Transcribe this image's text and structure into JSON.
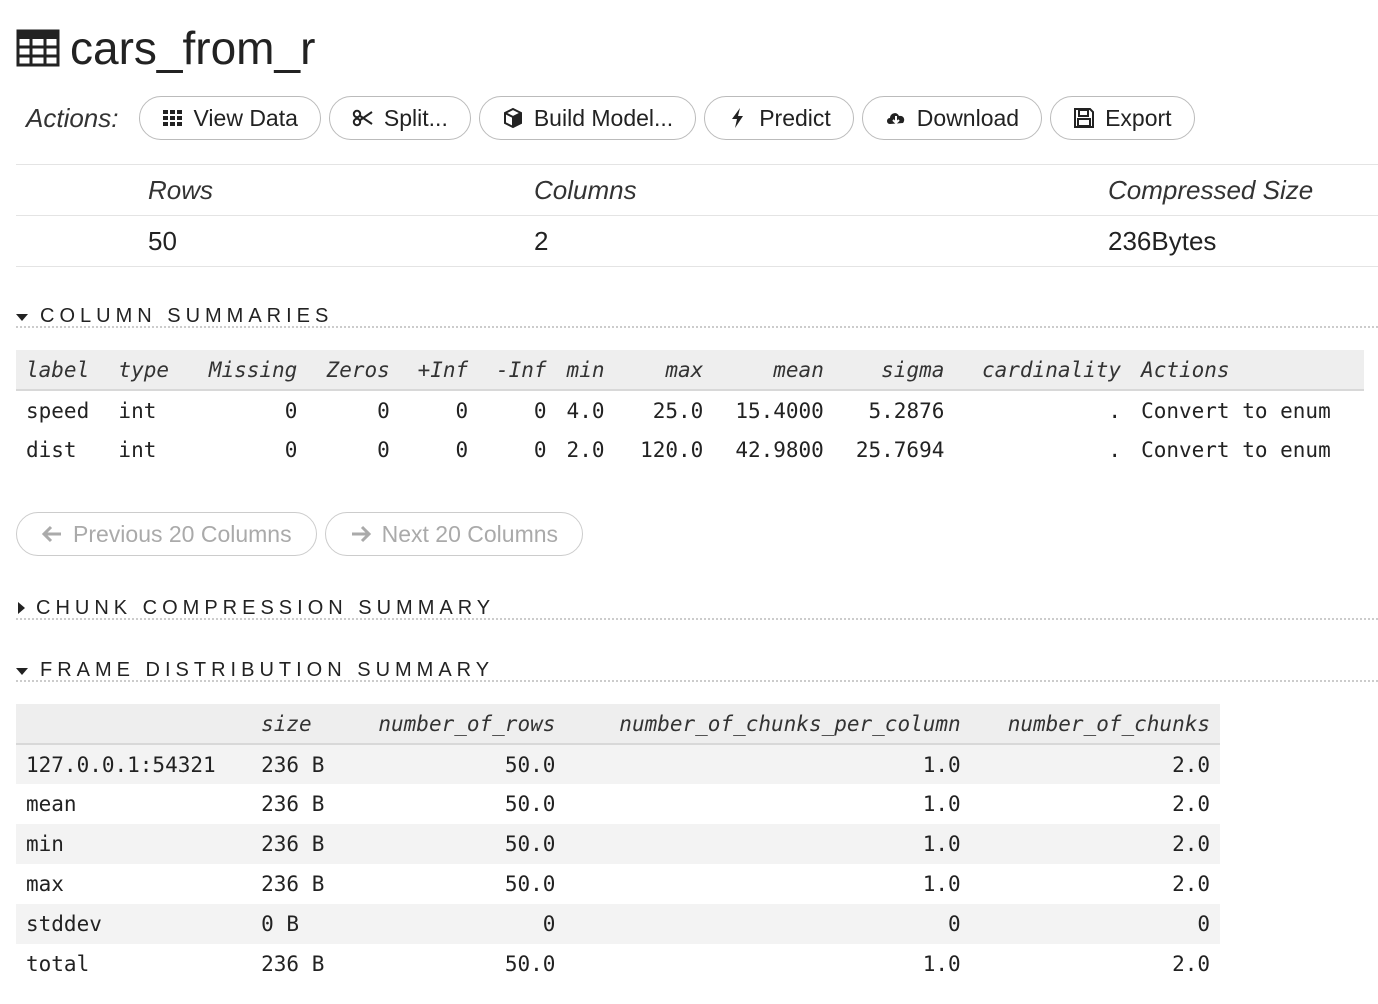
{
  "frame": {
    "name": "cars_from_r"
  },
  "actions": {
    "label": "Actions:",
    "buttons": {
      "view_data": "View Data",
      "split": "Split...",
      "build_model": "Build Model...",
      "predict": "Predict",
      "download": "Download",
      "export": "Export"
    }
  },
  "stats": {
    "headers": {
      "rows": "Rows",
      "columns": "Columns",
      "size": "Compressed Size"
    },
    "values": {
      "rows": "50",
      "columns": "2",
      "size": "236Bytes"
    }
  },
  "sections": {
    "column_summaries": "COLUMN SUMMARIES",
    "chunk_compression": "CHUNK COMPRESSION SUMMARY",
    "frame_distribution": "FRAME DISTRIBUTION SUMMARY"
  },
  "column_table": {
    "headers": [
      "label",
      "type",
      "Missing",
      "Zeros",
      "+Inf",
      "-Inf",
      "min",
      "max",
      "mean",
      "sigma",
      "cardinality",
      "Actions"
    ],
    "rows": [
      {
        "label": "speed",
        "type": "int",
        "missing": "0",
        "zeros": "0",
        "pinf": "0",
        "ninf": "0",
        "min": "4.0",
        "max": "25.0",
        "mean": "15.4000",
        "sigma": "5.2876",
        "cardinality": ".",
        "action": "Convert to enum"
      },
      {
        "label": "dist",
        "type": "int",
        "missing": "0",
        "zeros": "0",
        "pinf": "0",
        "ninf": "0",
        "min": "2.0",
        "max": "120.0",
        "mean": "42.9800",
        "sigma": "25.7694",
        "cardinality": ".",
        "action": "Convert to enum"
      }
    ]
  },
  "pager": {
    "prev": "Previous 20 Columns",
    "next": "Next 20 Columns"
  },
  "distribution_table": {
    "headers": [
      "",
      "size",
      "number_of_rows",
      "number_of_chunks_per_column",
      "number_of_chunks"
    ],
    "rows": [
      {
        "name": "127.0.0.1:54321",
        "size": "236 B",
        "rows": "50.0",
        "cpc": "1.0",
        "chunks": "2.0"
      },
      {
        "name": "mean",
        "size": "236 B",
        "rows": "50.0",
        "cpc": "1.0",
        "chunks": "2.0"
      },
      {
        "name": "min",
        "size": "236 B",
        "rows": "50.0",
        "cpc": "1.0",
        "chunks": "2.0"
      },
      {
        "name": "max",
        "size": "236 B",
        "rows": "50.0",
        "cpc": "1.0",
        "chunks": "2.0"
      },
      {
        "name": "stddev",
        "size": "0 B",
        "rows": "0",
        "cpc": "0",
        "chunks": "0"
      },
      {
        "name": "total",
        "size": "236 B",
        "rows": "50.0",
        "cpc": "1.0",
        "chunks": "2.0"
      }
    ]
  }
}
